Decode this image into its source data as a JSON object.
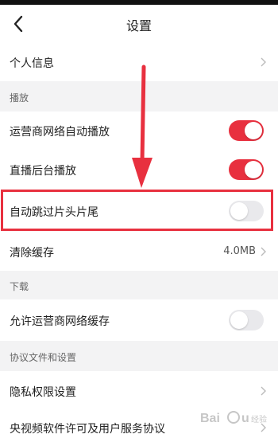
{
  "header": {
    "title": "设置"
  },
  "rows": {
    "personal_info": "个人信息",
    "auto_play_cellular": "运营商网络自动播放",
    "background_play": "直播后台播放",
    "skip_intro_outro": "自动跳过片头片尾",
    "clear_cache": "清除缓存",
    "cache_size": "4.0MB",
    "allow_cellular_cache": "允许运营商网络缓存",
    "privacy": "隐私权限设置",
    "license": "央视频软件许可及用户服务协议"
  },
  "sections": {
    "playback": "播放",
    "download": "下载",
    "agreements": "协议文件和设置"
  },
  "toggles": {
    "auto_play_cellular": true,
    "background_play": true,
    "skip_intro_outro": false,
    "allow_cellular_cache": false
  },
  "colors": {
    "accent": "#e8303f",
    "section_bg": "#f3f3f4"
  },
  "watermark": "Baidu 经验"
}
